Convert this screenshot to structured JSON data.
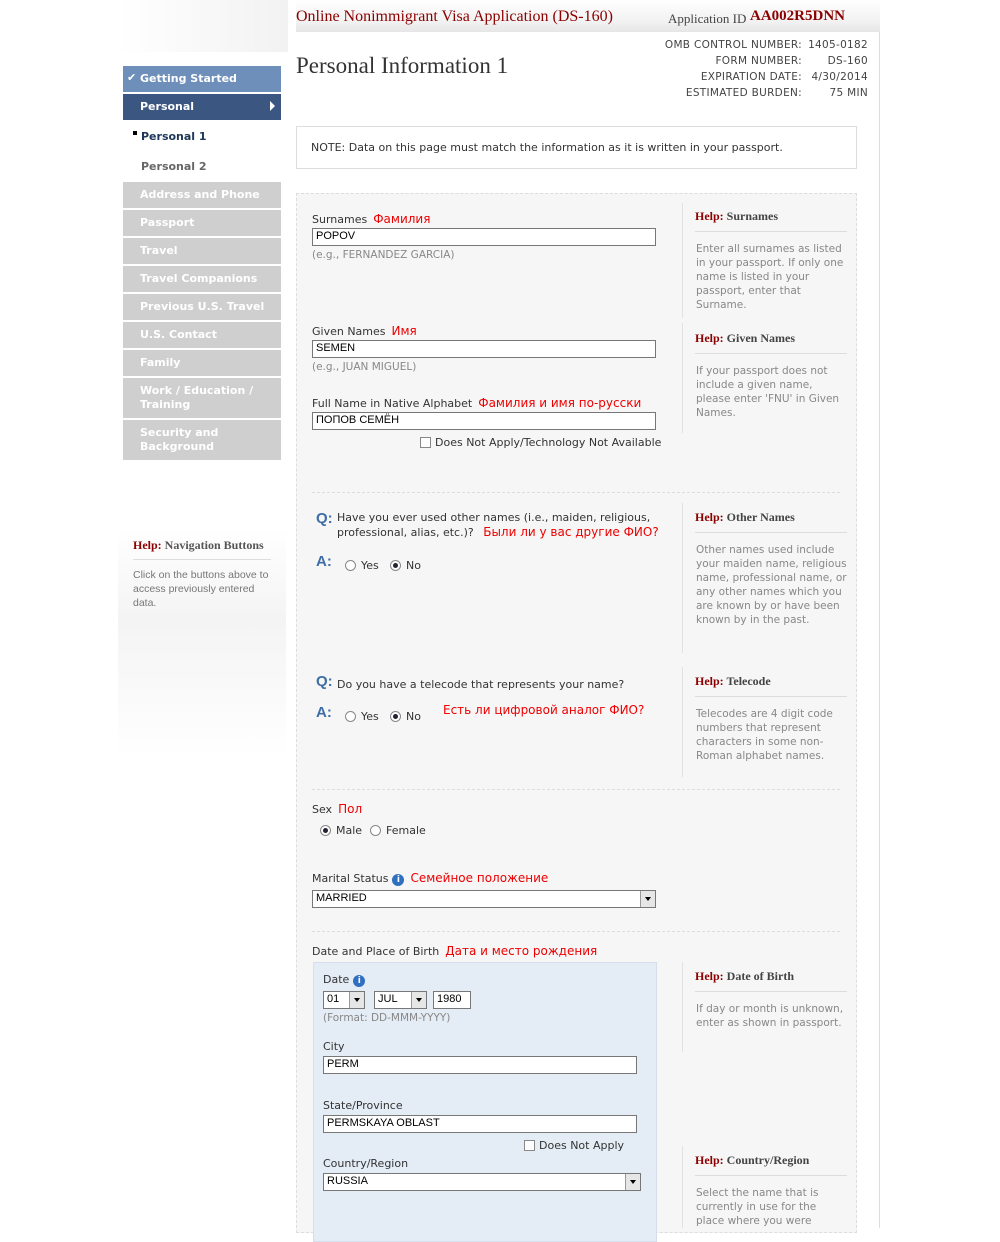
{
  "app": {
    "title": "Online Nonimmigrant Visa Application (DS-160)",
    "id_label": "Application ID",
    "id": "AA002R5DNN"
  },
  "page_title": "Personal Information 1",
  "omb": [
    {
      "k": "OMB CONTROL NUMBER:",
      "v": "1405-0182"
    },
    {
      "k": "FORM NUMBER:",
      "v": "DS-160"
    },
    {
      "k": "EXPIRATION DATE:",
      "v": "4/30/2014"
    },
    {
      "k": "ESTIMATED BURDEN:",
      "v": "75 MIN"
    }
  ],
  "nav": {
    "getting_started": "Getting Started",
    "personal": "Personal",
    "personal1": "Personal 1",
    "personal2": "Personal 2",
    "address": "Address and Phone",
    "passport": "Passport",
    "travel": "Travel",
    "companions": "Travel Companions",
    "prev_travel": "Previous U.S. Travel",
    "us_contact": "U.S. Contact",
    "family": "Family",
    "work": "Work / Education / Training",
    "security": "Security and Background"
  },
  "nav_help": {
    "prefix": "Help:",
    "title": "Navigation Buttons",
    "text": "Click on the buttons above to access previously entered data."
  },
  "note": "NOTE: Data on this page must match the information as it is written in your passport.",
  "surnames": {
    "label": "Surnames",
    "ru": "Фамилия",
    "value": "POPOV",
    "hint": "(e.g., FERNANDEZ GARCIA)"
  },
  "given": {
    "label": "Given Names",
    "ru": "Имя",
    "value": "SEMEN",
    "hint": "(e.g., JUAN MIGUEL)"
  },
  "native": {
    "label": "Full Name in Native Alphabet",
    "ru": "Фамилия и имя по-русски",
    "value": "ПОПОВ СЕМЁН",
    "na": "Does Not Apply/Technology Not Available"
  },
  "help": {
    "prefix": "Help:",
    "surnames_t": "Surnames",
    "surnames_b": "Enter all surnames as listed in your passport. If only one name is listed in your passport, enter that Surname.",
    "given_t": "Given Names",
    "given_b": "If your passport does not include a given name, please enter 'FNU' in Given Names.",
    "other_t": "Other Names",
    "other_b": "Other names used include your maiden name, religious name, professional name, or any other names which you are known by or have been known by in the past.",
    "telecode_t": "Telecode",
    "telecode_b": "Telecodes are 4 digit code numbers that represent characters in some non-Roman alphabet names.",
    "dob_t": "Date of Birth",
    "dob_b": "If day or month is unknown, enter as shown in passport.",
    "country_t": "Country/Region",
    "country_b": "Select the name that is currently in use for the place where you were"
  },
  "q_other": {
    "q": "Q:",
    "text": "Have you ever used other names (i.e., maiden, religious, professional, alias, etc.)?",
    "ru": "Были ли у вас другие ФИО?",
    "a": "A:",
    "yes": "Yes",
    "no": "No"
  },
  "q_tele": {
    "q": "Q:",
    "text": "Do you have a telecode that represents your name?",
    "ru": "Есть ли цифровой аналог ФИО?",
    "a": "A:",
    "yes": "Yes",
    "no": "No"
  },
  "sex": {
    "label": "Sex",
    "ru": "Пол",
    "male": "Male",
    "female": "Female"
  },
  "marital": {
    "label": "Marital Status",
    "ru": "Семейное положение",
    "value": "MARRIED",
    "info": "i"
  },
  "dob": {
    "section": "Date and Place of Birth",
    "ru": "Дата и место рождения",
    "date_label": "Date",
    "day": "01",
    "month": "JUL",
    "year": "1980",
    "format": "(Format: DD-MMM-YYYY)",
    "city_label": "City",
    "city": "PERM",
    "state_label": "State/Province",
    "state": "PERMSKAYA OBLAST",
    "state_na": "Does Not Apply",
    "country_label": "Country/Region",
    "country": "RUSSIA",
    "info": "i"
  }
}
